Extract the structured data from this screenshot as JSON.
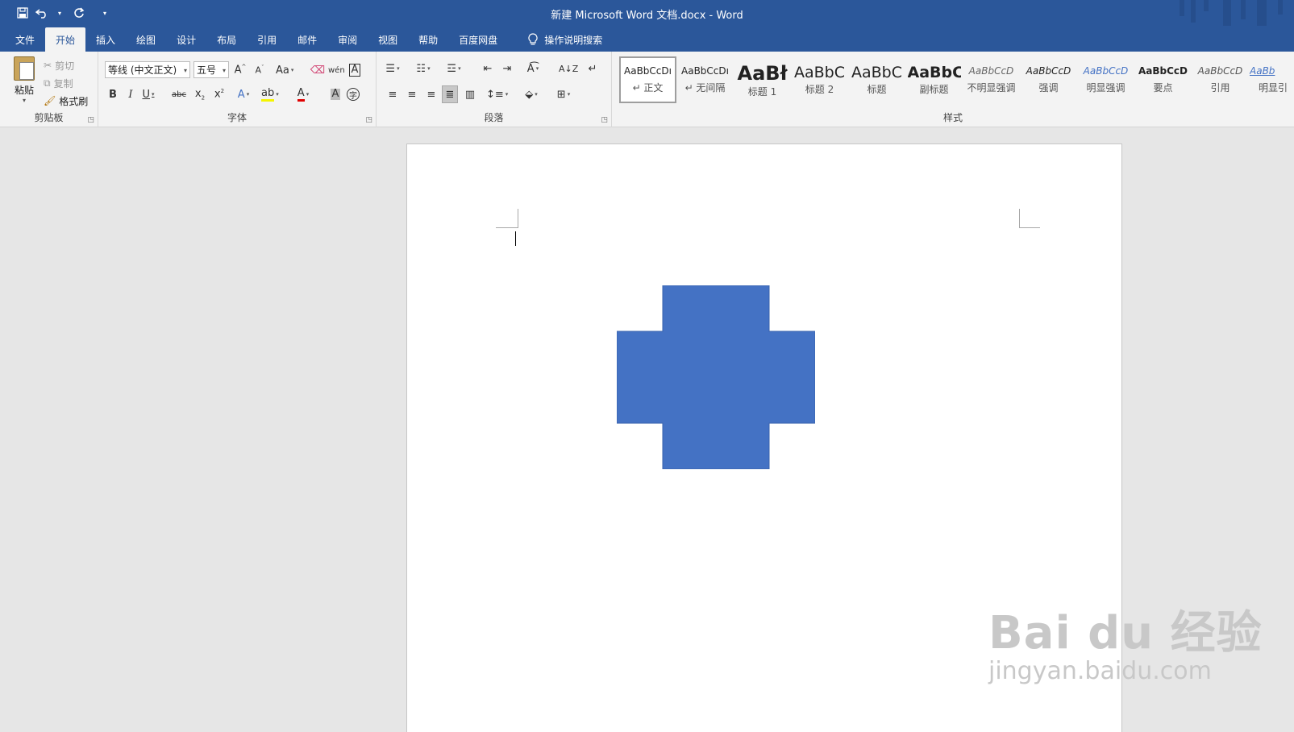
{
  "window": {
    "title": "新建 Microsoft Word 文档.docx  -  Word"
  },
  "quick_access": [
    "save-icon",
    "undo-icon",
    "redo-icon",
    "customize-icon"
  ],
  "tabs": [
    {
      "label": "文件",
      "active": false
    },
    {
      "label": "开始",
      "active": true
    },
    {
      "label": "插入",
      "active": false
    },
    {
      "label": "绘图",
      "active": false
    },
    {
      "label": "设计",
      "active": false
    },
    {
      "label": "布局",
      "active": false
    },
    {
      "label": "引用",
      "active": false
    },
    {
      "label": "邮件",
      "active": false
    },
    {
      "label": "审阅",
      "active": false
    },
    {
      "label": "视图",
      "active": false
    },
    {
      "label": "帮助",
      "active": false
    },
    {
      "label": "百度网盘",
      "active": false
    }
  ],
  "tell_me": "操作说明搜索",
  "clipboard": {
    "paste": "粘贴",
    "cut": "剪切",
    "copy": "复制",
    "format_painter": "格式刷",
    "label": "剪贴板"
  },
  "font": {
    "name": "等线 (中文正文)",
    "size": "五号",
    "label": "字体"
  },
  "paragraph": {
    "label": "段落"
  },
  "styles": {
    "label": "样式",
    "items": [
      {
        "sample": "AaBbCcDı",
        "name": "↵ 正文"
      },
      {
        "sample": "AaBbCcDı",
        "name": "↵ 无间隔"
      },
      {
        "sample": "AaBł",
        "name": "标题 1"
      },
      {
        "sample": "AaBbC",
        "name": "标题 2"
      },
      {
        "sample": "AaBbC",
        "name": "标题"
      },
      {
        "sample": "AaBbC",
        "name": "副标题"
      },
      {
        "sample": "AaBbCcD",
        "name": "不明显强调"
      },
      {
        "sample": "AaBbCcD",
        "name": "强调"
      },
      {
        "sample": "AaBbCcD",
        "name": "明显强调"
      },
      {
        "sample": "AaBbCcD",
        "name": "要点"
      },
      {
        "sample": "AaBbCcD",
        "name": "引用"
      },
      {
        "sample": "AaBb",
        "name": "明显引"
      }
    ]
  },
  "colors": {
    "titlebar": "#2b579a",
    "shape_fill": "#4472c4",
    "font_color": "#e00000",
    "highlight": "#f5f500"
  },
  "watermark": {
    "main": "Bai du 经验",
    "sub": "jingyan.baidu.com"
  }
}
